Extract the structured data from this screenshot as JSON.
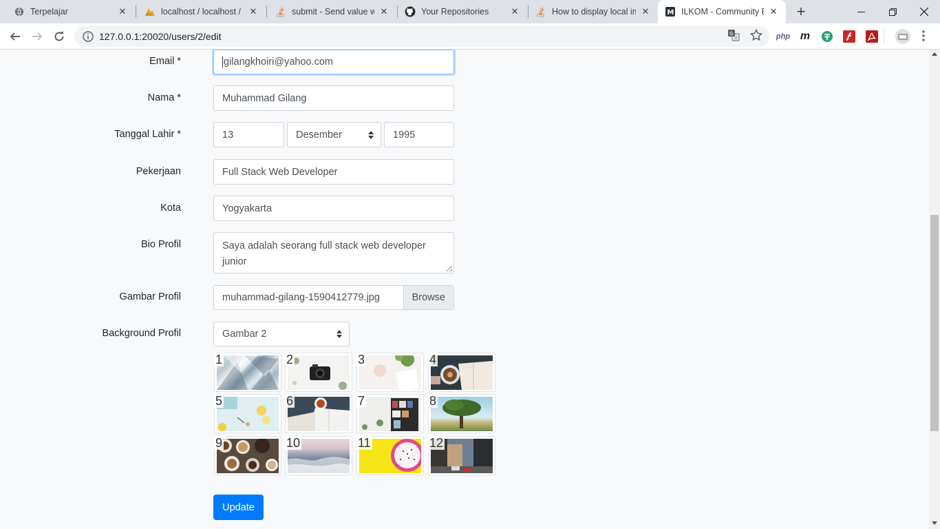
{
  "browser": {
    "tabs": [
      {
        "title": "Terpelajar",
        "favicon": "globe-icon"
      },
      {
        "title": "localhost / localhost / r",
        "favicon": "phpmyadmin-icon"
      },
      {
        "title": "submit - Send value wit",
        "favicon": "stackoverflow-icon"
      },
      {
        "title": "Your Repositories",
        "favicon": "github-icon"
      },
      {
        "title": "How to display local im",
        "favicon": "stackoverflow-icon"
      },
      {
        "title": "ILKOM - Community Bl",
        "favicon": "ilkom-m-icon",
        "active": true
      }
    ],
    "url": "127.0.0.1:20020/users/2/edit",
    "extensions": [
      "php-icon",
      "m-icon",
      "tether-icon",
      "flash-icon",
      "acrobat-icon"
    ]
  },
  "form": {
    "email": {
      "label": "Email *",
      "value": "gilangkhoiri@yahoo.com"
    },
    "nama": {
      "label": "Nama *",
      "value": "Muhammad Gilang"
    },
    "tanggal_lahir": {
      "label": "Tanggal Lahir *",
      "day": "13",
      "month": "Desember",
      "year": "1995"
    },
    "pekerjaan": {
      "label": "Pekerjaan",
      "value": "Full Stack Web Developer"
    },
    "kota": {
      "label": "Kota",
      "value": "Yogyakarta"
    },
    "bio": {
      "label": "Bio Profil",
      "value": "Saya adalah seorang full stack web developer junior"
    },
    "gambar": {
      "label": "Gambar Profil",
      "filename": "muhammad-gilang-1590412779.jpg",
      "browse": "Browse"
    },
    "background": {
      "label": "Background Profil",
      "selected": "Gambar 2"
    },
    "thumbnails": [
      {
        "n": "1",
        "theme": "geometric-triangles"
      },
      {
        "n": "2",
        "theme": "camera-on-white"
      },
      {
        "n": "3",
        "theme": "plant-and-notebook"
      },
      {
        "n": "4",
        "theme": "coffee-and-book"
      },
      {
        "n": "5",
        "theme": "lemon-tea"
      },
      {
        "n": "6",
        "theme": "tea-and-reading"
      },
      {
        "n": "7",
        "theme": "desk-shelves"
      },
      {
        "n": "8",
        "theme": "tree-landscape"
      },
      {
        "n": "9",
        "theme": "coffee-cups"
      },
      {
        "n": "10",
        "theme": "sea-waves"
      },
      {
        "n": "11",
        "theme": "dragonfruit-yellow"
      },
      {
        "n": "12",
        "theme": "city-street"
      }
    ],
    "submit": "Update"
  }
}
